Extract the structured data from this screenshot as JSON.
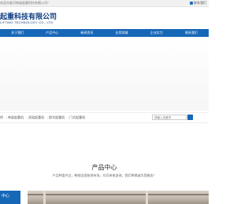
{
  "topbar": {
    "welcome": "欢迎光临河南省起重科技有限公司！",
    "contact": "联系我们"
  },
  "header": {
    "company_cn": "起重科技有限公司",
    "company_en": "LIFTING TECHNOLOGY CO., LTD"
  },
  "nav": {
    "items": [
      "关于我们",
      "产品中心",
      "新闻资讯",
      "应用领域",
      "企业实力",
      "联系我们"
    ]
  },
  "catbar": {
    "items": [
      "单梁起重机",
      "双梁起重机",
      "欧式起重机",
      "门式起重机"
    ],
    "suffix_first": "桥",
    "search_placeholder": "请输入关键词"
  },
  "products": {
    "title": "产品中心",
    "subtitle": "产品种类齐全，畅销全国各地市场，均可来电咨询，我们将竭诚为您服务！",
    "side_label": "中心"
  },
  "colors": {
    "nav": "#1767b7",
    "brand_text": "#0d3c80"
  }
}
